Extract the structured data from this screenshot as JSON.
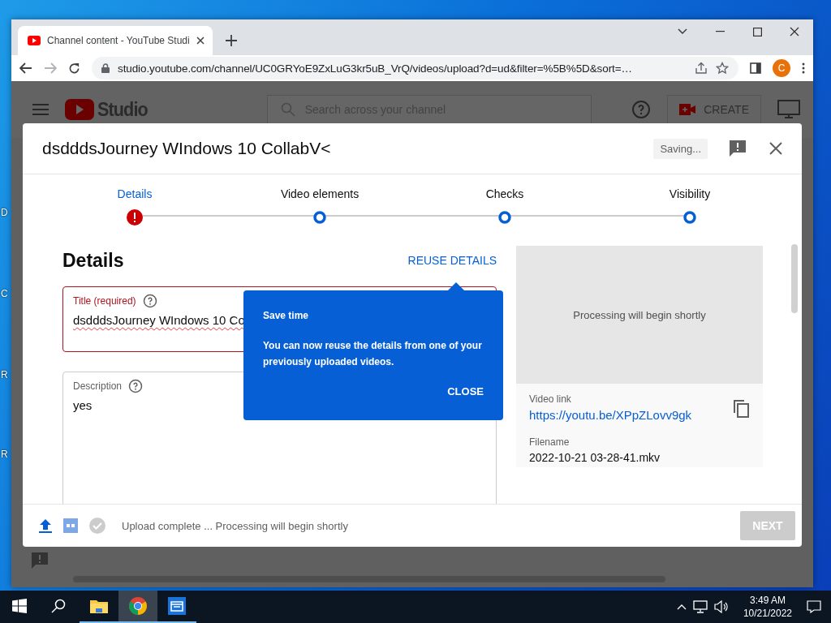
{
  "desktop": {
    "icon_labels": [
      "D",
      "C",
      "R",
      "R"
    ]
  },
  "browser": {
    "tab": {
      "title": "Channel content - YouTube Studi",
      "selected": true
    },
    "address": "studio.youtube.com/channel/UC0GRYoE9ZxLuG3kr5uB_VrQ/videos/upload?d=ud&filter=%5B%5D&sort=…",
    "profile_initial": "C"
  },
  "studio_header": {
    "logo": "Studio",
    "search": {
      "placeholder": "Search across your channel"
    },
    "create": "CREATE"
  },
  "dialog": {
    "title": "dsdddsJourney WIndows 10 CollabV<",
    "saving": "Saving...",
    "steps": [
      {
        "label": "Details",
        "selected": true,
        "kind": "error"
      },
      {
        "label": "Video elements",
        "selected": false,
        "kind": "pending"
      },
      {
        "label": "Checks",
        "selected": false,
        "kind": "pending"
      },
      {
        "label": "Visibility",
        "selected": false,
        "kind": "pending"
      }
    ],
    "heading": "Details",
    "reuse": "REUSE DETAILS",
    "title_field": {
      "label": "Title (required)",
      "value": "dsdddsJourney WIndows 10 Co",
      "error": true
    },
    "description_field": {
      "label": "Description",
      "value": "yes"
    },
    "preview": {
      "message": "Processing will begin shortly"
    },
    "video_link": {
      "label": "Video link",
      "url": "https://youtu.be/XPpZLovv9gk"
    },
    "filename": {
      "label": "Filename",
      "value": "2022-10-21 03-28-41.mkv"
    },
    "popover": {
      "title": "Save time",
      "text": "You can now reuse the details from one of your previously uploaded videos.",
      "button": "CLOSE"
    },
    "footer": {
      "status": "Upload complete ... Processing will begin shortly",
      "next": {
        "label": "NEXT",
        "disabled": true
      }
    }
  },
  "taskbar": {
    "apps": [
      {
        "kind": "explorer",
        "selected": false
      },
      {
        "kind": "chrome",
        "selected": true
      },
      {
        "kind": "window",
        "selected": false
      }
    ],
    "time": "3:49 AM",
    "date": "10/21/2022"
  }
}
